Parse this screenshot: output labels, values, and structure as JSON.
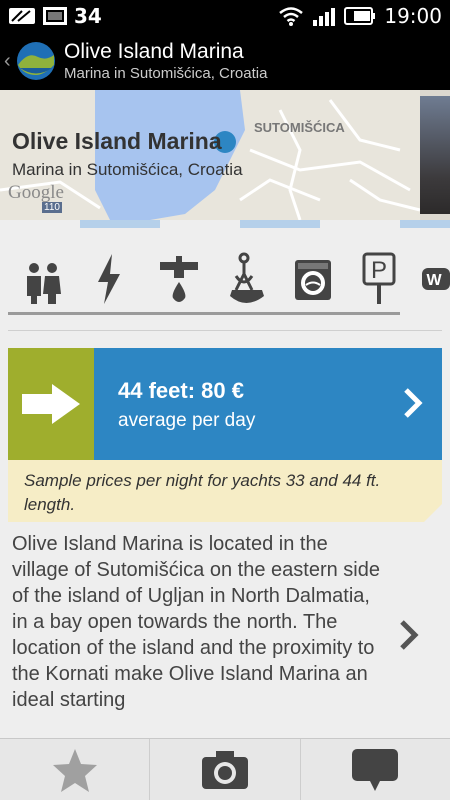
{
  "status_bar": {
    "notification_count": "34",
    "time": "19:00"
  },
  "action_bar": {
    "title": "Olive Island Marina",
    "subtitle": "Marina in Sutomišćica, Croatia"
  },
  "map": {
    "title": "Olive Island Marina",
    "subtitle": "Marina in Sutomišćica, Croatia",
    "town_label": "SUTOMIŠĆICA",
    "google_label": "Google",
    "road_label": "110"
  },
  "amenities": [
    {
      "icon": "restroom-icon"
    },
    {
      "icon": "electricity-icon"
    },
    {
      "icon": "water-tap-icon"
    },
    {
      "icon": "crane-hook-icon"
    },
    {
      "icon": "washing-machine-icon"
    },
    {
      "icon": "parking-icon"
    },
    {
      "icon": "wifi-icon",
      "label": "W"
    }
  ],
  "price": {
    "value": "44 feet: 80 €",
    "period": "average per day",
    "note": "Sample prices per night for yachts 33 and 44 ft. length."
  },
  "description": "Olive Island Marina is located in the village of Sutomišćica on the eastern side of the island of Ugljan in North Dalmatia, in a bay open towards the north. The location of the island and the proximity to the Kornati make Olive Island Marina an ideal starting",
  "bottom_bar": [
    {
      "icon": "star-icon"
    },
    {
      "icon": "camera-icon"
    },
    {
      "icon": "comment-icon"
    }
  ],
  "colors": {
    "accent_blue": "#2d86c3",
    "accent_green": "#9fae2d",
    "note_bg": "#f6edc6"
  }
}
